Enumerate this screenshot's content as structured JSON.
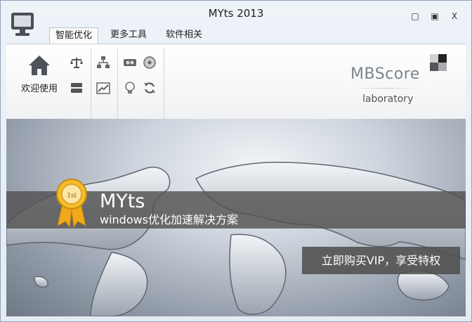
{
  "window": {
    "title": "MYts 2013",
    "icon": "monitor-icon"
  },
  "controls": {
    "minimize": "□",
    "maximize": "▣",
    "close": "X"
  },
  "tabs": [
    {
      "label": "智能优化",
      "active": true
    },
    {
      "label": "更多工具",
      "active": false
    },
    {
      "label": "软件相关",
      "active": false
    }
  ],
  "ribbon": {
    "home": {
      "label": "欢迎使用",
      "icon": "home-icon"
    },
    "icons": [
      "balance-icon",
      "database-icon",
      "network-icon",
      "chart-up-icon",
      "memory-icon",
      "disc-icon",
      "bulb-icon",
      "refresh-icon"
    ]
  },
  "brand": {
    "name": "MBScore",
    "tagline": "laboratory"
  },
  "banner": {
    "title": "MYts",
    "subtitle": "windows优化加速解决方案",
    "medal_text": "1st",
    "vip_label": "立即购买VIP，享受特权"
  },
  "colors": {
    "accent": "#7c858c",
    "band": "#525252",
    "medal": "#f2b21c"
  }
}
